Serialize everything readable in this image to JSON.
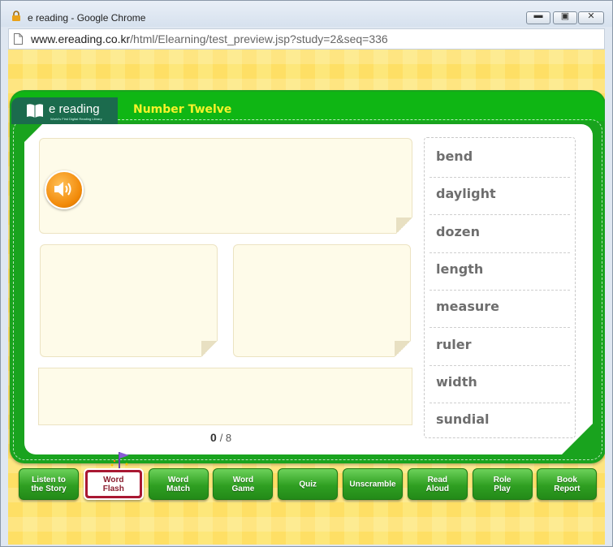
{
  "window": {
    "title": "e reading - Google Chrome",
    "url_host": "www.ereading.co.kr",
    "url_path": "/html/Elearning/test_preview.jsp?study=2&seq=336"
  },
  "app": {
    "logo_text": "e reading",
    "logo_subtitle": "World's First Digital Reading Library",
    "unit_title": "Number Twelve"
  },
  "activity": {
    "score_current": "0",
    "score_total": "/ 8"
  },
  "word_list": [
    "bend",
    "daylight",
    "dozen",
    "length",
    "measure",
    "ruler",
    "width",
    "sundial"
  ],
  "menu": [
    {
      "label": "Listen to\nthe Story",
      "active": false
    },
    {
      "label": "Word\nFlash",
      "active": true
    },
    {
      "label": "Word\nMatch",
      "active": false
    },
    {
      "label": "Word\nGame",
      "active": false
    },
    {
      "label": "Quiz",
      "active": false
    },
    {
      "label": "Unscramble",
      "active": false
    },
    {
      "label": "Read\nAloud",
      "active": false
    },
    {
      "label": "Role\nPlay",
      "active": false
    },
    {
      "label": "Book\nReport",
      "active": false
    }
  ],
  "colors": {
    "board_green": "#19a31e",
    "title_yellow": "#f6f32a",
    "active_menu": "#a91832",
    "speaker_orange": "#f28a09"
  }
}
